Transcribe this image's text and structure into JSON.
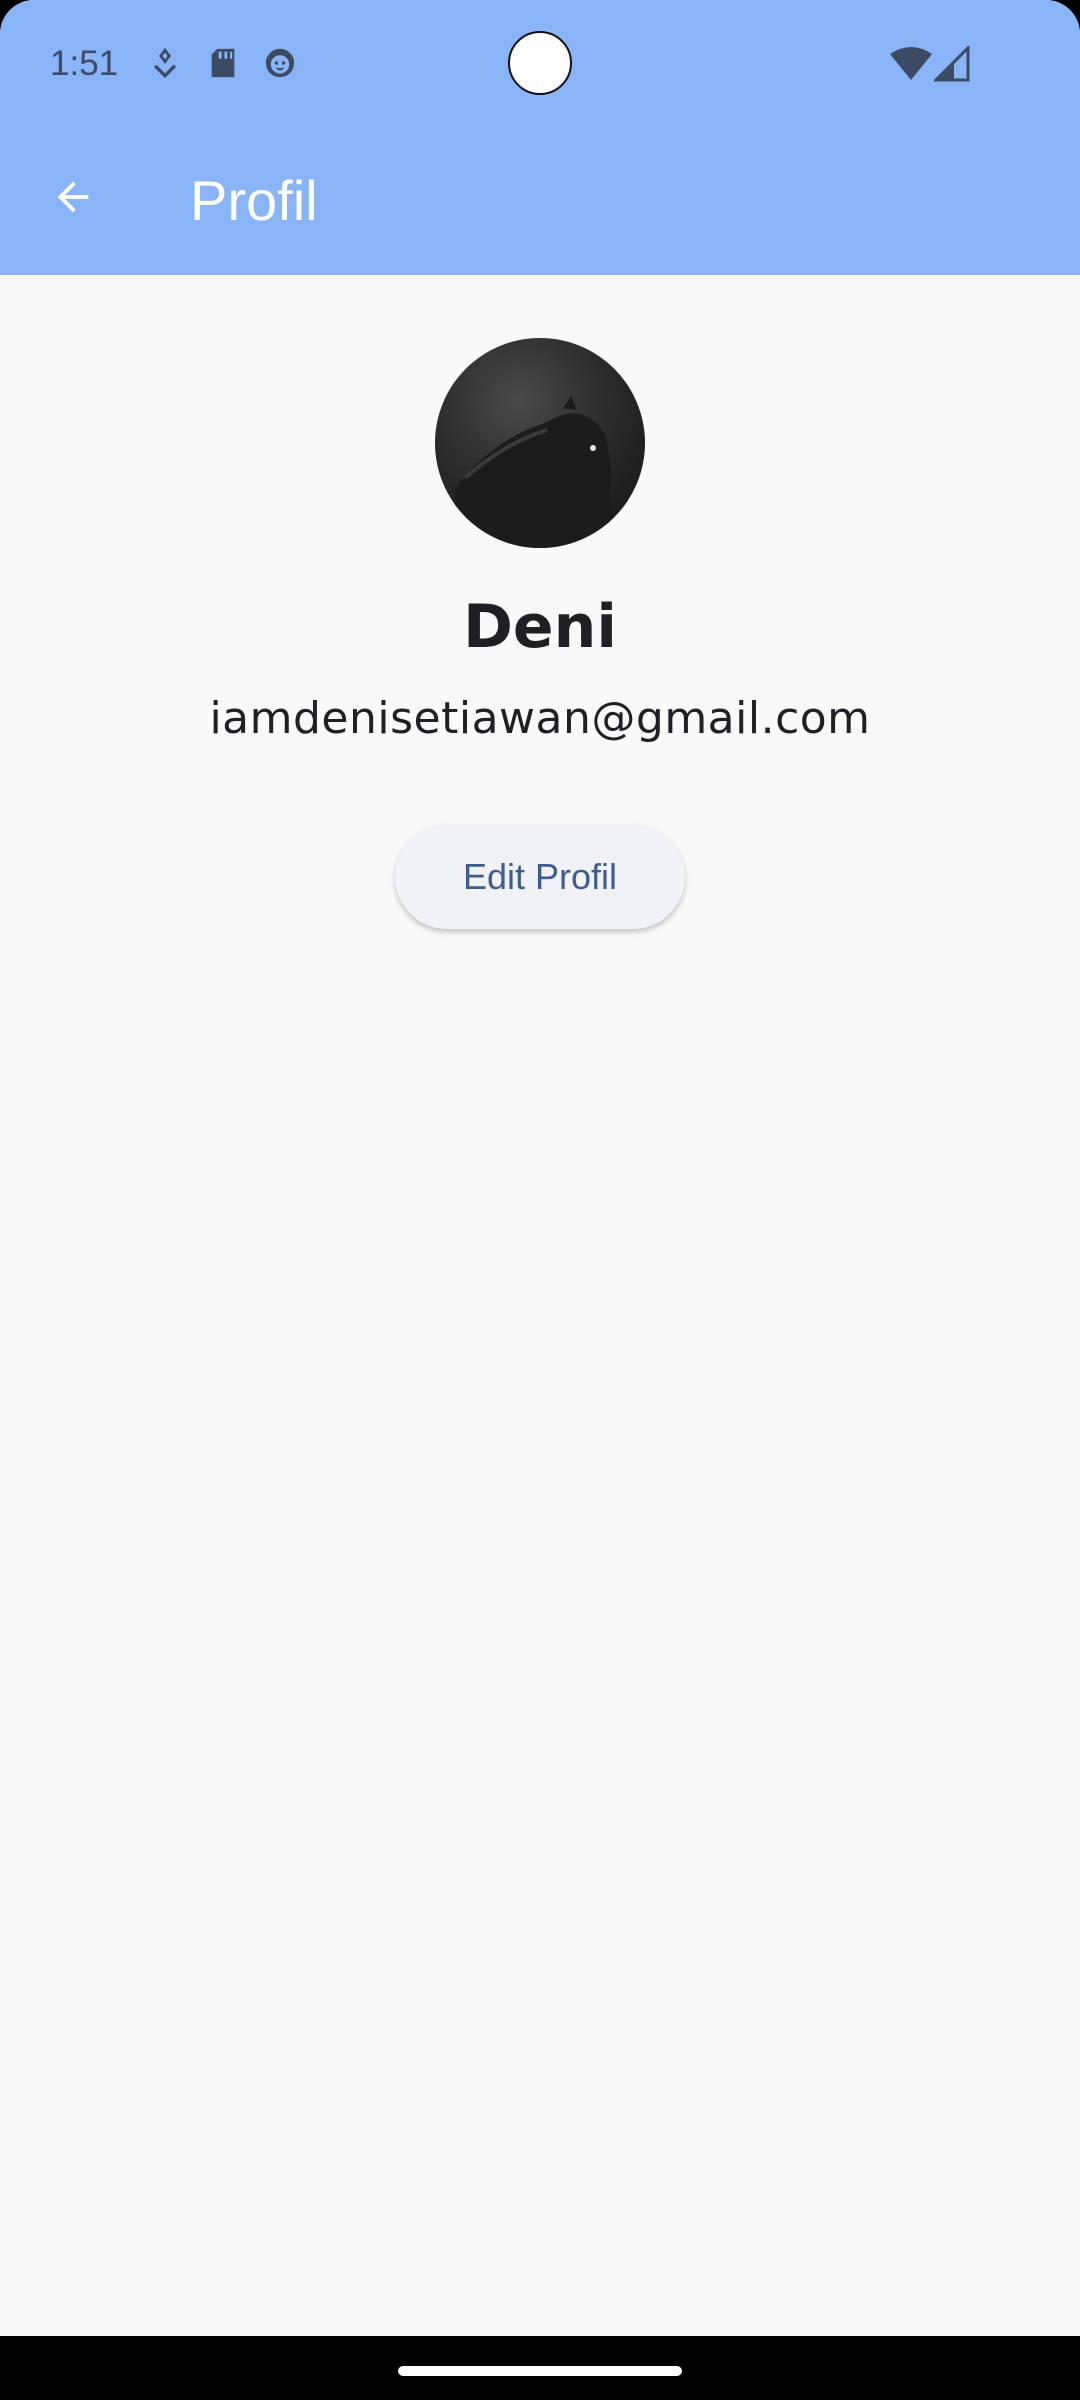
{
  "status_bar": {
    "time": "1:51",
    "icons": [
      "location-drop-icon",
      "sd-card-icon",
      "face-icon",
      "wifi-icon",
      "cellular-signal-icon"
    ]
  },
  "app_bar": {
    "title": "Profil",
    "back_icon": "arrow-back-icon",
    "background_color": "#8ab4f8"
  },
  "profile": {
    "name": "Deni",
    "email": "iamdenisetiawan@gmail.com",
    "edit_button_label": "Edit Profil"
  },
  "colors": {
    "page_background": "#f9f9f9",
    "button_text": "#3f5d8c",
    "button_background": "#f1f2f8"
  }
}
